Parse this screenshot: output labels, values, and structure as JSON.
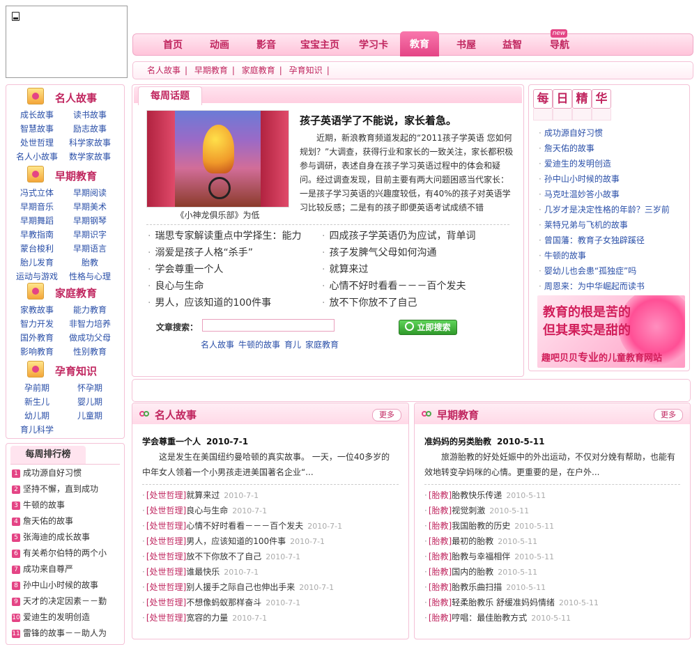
{
  "nav": {
    "items": [
      "首页",
      "动画",
      "影音",
      "宝宝主页",
      "学习卡",
      "教育",
      "书屋",
      "益智",
      "导航"
    ],
    "active": "教育",
    "new_badge": "new"
  },
  "subnav": [
    "名人故事",
    "早期教育",
    "家庭教育",
    "孕育知识"
  ],
  "left_categories": [
    {
      "title": "名人故事",
      "items": [
        "成长故事",
        "读书故事",
        "智慧故事",
        "励志故事",
        "处世哲理",
        "科学家故事",
        "名人小故事",
        "数学家故事"
      ]
    },
    {
      "title": "早期教育",
      "items": [
        "冯式立体",
        "早期阅读",
        "早期音乐",
        "早期美术",
        "早期舞蹈",
        "早期钢琴",
        "早教指南",
        "早期识字",
        "蒙台梭利",
        "早期语言",
        "胎儿发育",
        "胎教",
        "运动与游戏",
        "性格与心理"
      ]
    },
    {
      "title": "家庭教育",
      "items": [
        "家教故事",
        "能力教育",
        "智力开发",
        "非智力培养",
        "国外教育",
        "做成功父母",
        "影响教育",
        "性别教育"
      ]
    },
    {
      "title": "孕育知识",
      "items": [
        "孕前期",
        "怀孕期",
        "新生儿",
        "婴儿期",
        "幼儿期",
        "儿童期",
        "育儿科学"
      ]
    }
  ],
  "rank": {
    "title": "每周排行榜",
    "items": [
      "成功源自好习惯",
      "坚持不懈，直到成功",
      "牛顿的故事",
      "詹天佑的故事",
      "张海迪的成长故事",
      "有关希尔伯特的两个小",
      "成功来自尊严",
      "孙中山小时候的故事",
      "天才的决定因素－－勤",
      "爱迪生的发明创造",
      "雷锋的故事－－助人为"
    ]
  },
  "topic": {
    "header": "每周话题",
    "caption": "《小神龙俱乐部》为低",
    "title": "孩子英语学了不能说，家长着急。",
    "text": "近期，新浪教育频道发起的“2011孩子学英语 您如何规划？”大调查，获得行业和家长的一致关注，家长都积极参与调研，表述自身在孩子学习英语过程中的体会和疑问。经过调查发现，目前主要有两大问题困惑当代家长：一是孩子学习英语的兴趣度较低，有40%的孩子对英语学习比较反感；二是有的孩子即便英语考试成绩不错",
    "links_left": [
      "瑞思专家解读重点中学择生：能力",
      "溺爱是孩子人格“杀手”",
      "学会尊重一个人",
      "良心与生命",
      "男人，应该知道的100件事"
    ],
    "links_right": [
      "四成孩子学英语仍为应试，背单词",
      "孩子发脾气父母如何沟通",
      "就算来过",
      "心情不好时看看－－－百个发夫",
      "放不下你放不了自己"
    ]
  },
  "search": {
    "label": "文章搜索：",
    "placeholder": "",
    "button": "立即搜索",
    "tags": [
      "名人故事",
      "牛顿的故事",
      "育儿",
      "家庭教育"
    ]
  },
  "right": {
    "chars": [
      "每",
      "日",
      "精",
      "华"
    ],
    "items": [
      "成功源自好习惯",
      "詹天佑的故事",
      "爱迪生的发明创造",
      "孙中山小时候的故事",
      "马克吐温妙答小故事",
      "几岁才是决定性格的年龄？三岁前",
      "莱特兄弟与飞机的故事",
      "曾国藩：教育子女独辟蹊径",
      "牛顿的故事",
      "婴幼儿也会患“孤独症”吗",
      "周恩来：为中华崛起而读书"
    ],
    "ad": {
      "line1": "教育的根是苦的",
      "line2": "但其果实是甜的",
      "line3_a": "趣吧贝贝",
      "line3_b": "专业",
      "line3_c": "的儿童教育网站"
    }
  },
  "panel_left": {
    "title": "名人故事",
    "more": "更多",
    "feature_title": "学会尊重一个人",
    "feature_date": "2010-7-1",
    "feature_text": "这是发生在美国纽约曼哈顿的真实故事。 一天，一位40多岁的中年女人领着一个小男孩走进美国著名企业“...",
    "rows": [
      {
        "tag": "[处世哲理]",
        "title": "就算来过",
        "date": "2010-7-1"
      },
      {
        "tag": "[处世哲理]",
        "title": "良心与生命",
        "date": "2010-7-1"
      },
      {
        "tag": "[处世哲理]",
        "title": "心情不好时看看－－－百个发夫",
        "date": "2010-7-1"
      },
      {
        "tag": "[处世哲理]",
        "title": "男人，应该知道的100件事",
        "date": "2010-7-1"
      },
      {
        "tag": "[处世哲理]",
        "title": "放不下你放不了自己",
        "date": "2010-7-1"
      },
      {
        "tag": "[处世哲理]",
        "title": "谁最快乐",
        "date": "2010-7-1"
      },
      {
        "tag": "[处世哲理]",
        "title": "别人援手之际自己也伸出手来",
        "date": "2010-7-1"
      },
      {
        "tag": "[处世哲理]",
        "title": "不想像蚂蚁那样奋斗",
        "date": "2010-7-1"
      },
      {
        "tag": "[处世哲理]",
        "title": "宽容的力量",
        "date": "2010-7-1"
      }
    ]
  },
  "panel_right": {
    "title": "早期教育",
    "more": "更多",
    "feature_title": "准妈妈的另类胎教",
    "feature_date": "2010-5-11",
    "feature_text": "旅游胎教的好处妊娠中的外出运动，不仅对分娩有帮助，也能有效地转变孕妈咪的心情。更重要的是，在户外...",
    "rows": [
      {
        "tag": "[胎教]",
        "title": "胎教快乐传递",
        "date": "2010-5-11"
      },
      {
        "tag": "[胎教]",
        "title": "视觉刺激",
        "date": "2010-5-11"
      },
      {
        "tag": "[胎教]",
        "title": "我国胎教的历史",
        "date": "2010-5-11"
      },
      {
        "tag": "[胎教]",
        "title": "最初的胎教",
        "date": "2010-5-11"
      },
      {
        "tag": "[胎教]",
        "title": "胎教与幸福相伴",
        "date": "2010-5-11"
      },
      {
        "tag": "[胎教]",
        "title": "国内的胎教",
        "date": "2010-5-11"
      },
      {
        "tag": "[胎教]",
        "title": "胎教乐曲扫描",
        "date": "2010-5-11"
      },
      {
        "tag": "[胎教]",
        "title": "轻柔胎教乐 舒缓准妈妈情绪",
        "date": "2010-5-11"
      },
      {
        "tag": "[胎教]",
        "title": "哼唱：最佳胎教方式",
        "date": "2010-5-11"
      }
    ]
  }
}
